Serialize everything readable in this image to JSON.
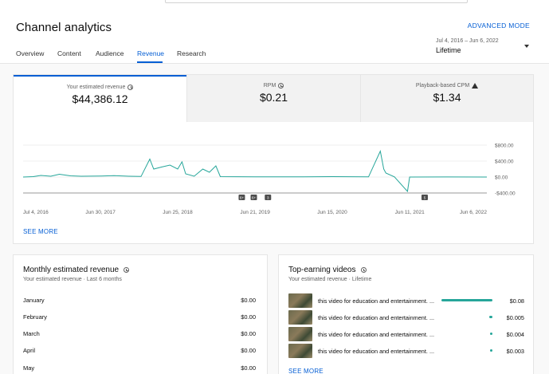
{
  "header": {
    "title": "Channel analytics",
    "advanced_mode": "ADVANCED MODE",
    "tabs": [
      {
        "label": "Overview"
      },
      {
        "label": "Content"
      },
      {
        "label": "Audience"
      },
      {
        "label": "Revenue",
        "active": true
      },
      {
        "label": "Research"
      }
    ],
    "date_range": {
      "range": "Jul 4, 2016 – Jun 6, 2022",
      "label": "Lifetime"
    }
  },
  "metrics": [
    {
      "label": "Your estimated revenue",
      "value": "$44,386.12",
      "icon": "clock-icon",
      "selected": true
    },
    {
      "label": "RPM",
      "value": "$0.21",
      "icon": "clock-icon"
    },
    {
      "label": "Playback-based CPM",
      "value": "$1.34",
      "icon": "warning-icon"
    }
  ],
  "chart_data": {
    "type": "line",
    "series": [
      {
        "values": [
          {
            "x": "2016-07-04",
            "y": 0
          },
          {
            "x": "2016-08-20",
            "y": 10
          },
          {
            "x": "2016-09-25",
            "y": 40
          },
          {
            "x": "2016-11-10",
            "y": 20
          },
          {
            "x": "2016-12-20",
            "y": 70
          },
          {
            "x": "2017-02-10",
            "y": 30
          },
          {
            "x": "2017-04-01",
            "y": 20
          },
          {
            "x": "2017-06-30",
            "y": 25
          },
          {
            "x": "2017-09-01",
            "y": 35
          },
          {
            "x": "2017-11-10",
            "y": 20
          },
          {
            "x": "2018-01-05",
            "y": 15
          },
          {
            "x": "2018-02-15",
            "y": 450
          },
          {
            "x": "2018-03-05",
            "y": 200
          },
          {
            "x": "2018-04-10",
            "y": 250
          },
          {
            "x": "2018-05-20",
            "y": 300
          },
          {
            "x": "2018-06-25",
            "y": 200
          },
          {
            "x": "2018-07-15",
            "y": 380
          },
          {
            "x": "2018-08-01",
            "y": 80
          },
          {
            "x": "2018-09-10",
            "y": 20
          },
          {
            "x": "2018-10-20",
            "y": 200
          },
          {
            "x": "2018-11-20",
            "y": 120
          },
          {
            "x": "2018-12-20",
            "y": 280
          },
          {
            "x": "2019-01-10",
            "y": 10
          },
          {
            "x": "2019-06-21",
            "y": 5
          },
          {
            "x": "2019-12-01",
            "y": 5
          },
          {
            "x": "2020-06-15",
            "y": 10
          },
          {
            "x": "2020-12-01",
            "y": 5
          },
          {
            "x": "2021-01-25",
            "y": 650
          },
          {
            "x": "2021-02-10",
            "y": 200
          },
          {
            "x": "2021-02-20",
            "y": 100
          },
          {
            "x": "2021-04-01",
            "y": 5
          },
          {
            "x": "2021-06-01",
            "y": -360
          },
          {
            "x": "2021-06-11",
            "y": 0
          },
          {
            "x": "2021-12-01",
            "y": 2
          },
          {
            "x": "2022-06-06",
            "y": 0
          }
        ]
      }
    ],
    "x_ticks": [
      "Jul 4, 2016",
      "Jun 30, 2017",
      "Jun 25, 2018",
      "Jun 21, 2019",
      "Jun 15, 2020",
      "Jun 11, 2021",
      "Jun 6, 2022"
    ],
    "y_ticks": [
      "$800.00",
      "$400.00",
      "$0.00",
      "-$400.00"
    ],
    "xlim": [
      "2016-07-04",
      "2022-06-06"
    ],
    "ylim": [
      -400,
      800
    ],
    "grid": true,
    "markers": [
      "6+",
      "6+",
      "3",
      "5"
    ]
  },
  "main_see_more": "SEE MORE",
  "monthly": {
    "title": "Monthly estimated revenue",
    "subtitle": "Your estimated revenue · Last 6 months",
    "rows": [
      {
        "month": "January",
        "amount": "$0.00"
      },
      {
        "month": "February",
        "amount": "$0.00"
      },
      {
        "month": "March",
        "amount": "$0.00"
      },
      {
        "month": "April",
        "amount": "$0.00"
      },
      {
        "month": "May",
        "amount": "$0.00"
      }
    ]
  },
  "top_videos": {
    "title": "Top-earning videos",
    "subtitle": "Your estimated revenue · Lifetime",
    "items": [
      {
        "title": "this video for education and entertainment. ...",
        "amount": "$0.08",
        "share": 1.0
      },
      {
        "title": "this video for education and entertainment. ...",
        "amount": "$0.005",
        "share": 0.06
      },
      {
        "title": "this video for education and entertainment. ...",
        "amount": "$0.004",
        "share": 0.05
      },
      {
        "title": "this video for education and entertainment. ...",
        "amount": "$0.003",
        "share": 0.04
      }
    ],
    "see_more": "SEE MORE"
  },
  "colors": {
    "accent": "#065fd4",
    "series": "#26a69a"
  }
}
